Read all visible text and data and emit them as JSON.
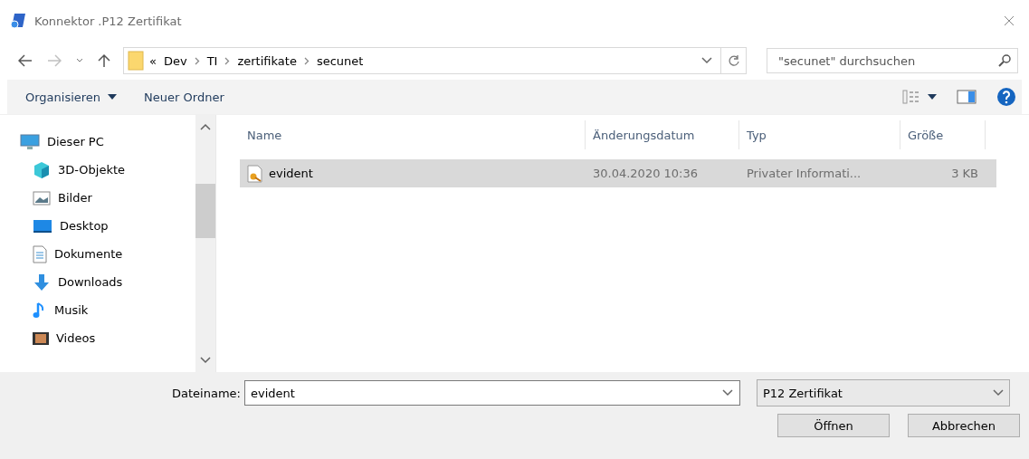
{
  "window": {
    "title": "Konnektor .P12 Zertifikat"
  },
  "breadcrumb": {
    "overflow": "«",
    "segments": [
      "Dev",
      "TI",
      "zertifikate",
      "secunet"
    ]
  },
  "search": {
    "placeholder": "\"secunet\" durchsuchen"
  },
  "toolbar": {
    "organize": "Organisieren",
    "new_folder": "Neuer Ordner"
  },
  "sidebar": {
    "items": [
      {
        "label": "Dieser PC",
        "children": [
          {
            "label": "3D-Objekte"
          },
          {
            "label": "Bilder"
          },
          {
            "label": "Desktop"
          },
          {
            "label": "Dokumente"
          },
          {
            "label": "Downloads"
          },
          {
            "label": "Musik"
          },
          {
            "label": "Videos"
          }
        ]
      }
    ]
  },
  "table": {
    "columns": [
      "Name",
      "Änderungsdatum",
      "Typ",
      "Größe"
    ],
    "rows": [
      {
        "name": "evident",
        "date": "30.04.2020 10:36",
        "type": "Privater Informati...",
        "size": "3 KB",
        "selected": true
      }
    ]
  },
  "footer": {
    "filename_label": "Dateiname:",
    "filename_value": "evident",
    "filetype": "P12 Zertifikat",
    "buttons": [
      "Öffnen",
      "Abbrechen"
    ]
  }
}
